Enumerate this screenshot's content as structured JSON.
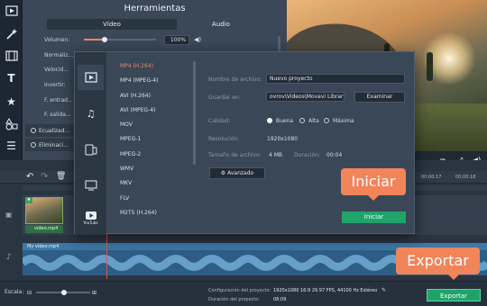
{
  "tools_panel": {
    "title": "Herramientas",
    "tabs": [
      "Vídeo",
      "Audio"
    ],
    "volume_label": "Volumen:",
    "volume_value": "100%",
    "rows": [
      "Normaliz...",
      "Velocid...",
      "Invertir:",
      "F. entrad...",
      "F. salida..."
    ],
    "options": [
      "Ecualizad...",
      "Eliminaci..."
    ]
  },
  "export_dialog": {
    "formats": [
      "MP4 (H.264)",
      "MP4 (MPEG-4)",
      "AVI (H.264)",
      "AVI (MPEG-4)",
      "MOV",
      "MPEG-1",
      "MPEG-2",
      "WMV",
      "MKV",
      "FLV",
      "M2TS (H.264)"
    ],
    "selected_format_index": 0,
    "format_icons": [
      "video-file-icon",
      "music-note-icon",
      "devices-icon",
      "tv-icon",
      "youtube-icon"
    ],
    "youtube_label": "YouTube",
    "filename_label": "Nombre de archivo:",
    "filename_value": "Nuevo proyecto",
    "save_label": "Guardar en:",
    "save_value": "ovrov\\Videos\\Movavi Library",
    "browse_label": "Examinar",
    "quality_label": "Calidad:",
    "quality_options": [
      "Buena",
      "Alta",
      "Máxima"
    ],
    "quality_selected": "Buena",
    "resolution_label": "Resolución:",
    "resolution_value": "1920x1080",
    "filesize_label": "Tamaño de archivo:",
    "filesize_value": "4 MB",
    "duration_label": "Duración:",
    "duration_value": "00:04",
    "advanced_label": "Avanzado",
    "start_label": "Iniciar"
  },
  "callouts": {
    "start": "Iniciar",
    "export": "Exportar"
  },
  "timeline": {
    "ruler_marks": [
      "00:00:17",
      "00:00:18"
    ],
    "video_clip_name": "video.mp4",
    "audio_clip_name": "My video.mp4"
  },
  "bottom_bar": {
    "scale_label": "Escala:",
    "project_config_label": "Configuración del proyecto:",
    "project_config_value": "1920x1080 16:9 29.97 FPS, 44100 Hz Estéreo",
    "project_duration_label": "Duración del proyecto:",
    "project_duration_value": "08:09",
    "export_label": "Exportar"
  }
}
